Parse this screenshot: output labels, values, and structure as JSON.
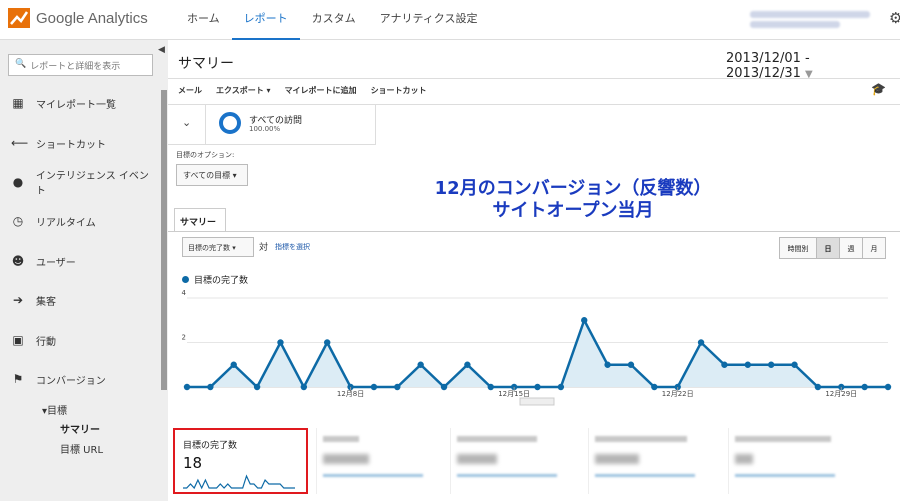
{
  "app": {
    "logo_text": "Google Analytics",
    "nav": [
      "ホーム",
      "レポート",
      "カスタム",
      "アナリティクス設定"
    ],
    "nav_active": 1
  },
  "sidebar": {
    "search_placeholder": "レポートと詳細を表示",
    "items": [
      {
        "icon": "grid-icon",
        "label": "マイレポート一覧"
      },
      {
        "icon": "shortcut-arrow-icon",
        "label": "ショートカット"
      },
      {
        "icon": "lightbulb-icon",
        "label": "インテリジェンス イベント"
      },
      {
        "icon": "clock-icon",
        "label": "リアルタイム"
      },
      {
        "icon": "users-icon",
        "label": "ユーザー"
      },
      {
        "icon": "acquisition-arrows-icon",
        "label": "集客"
      },
      {
        "icon": "behavior-box-icon",
        "label": "行動"
      },
      {
        "icon": "flag-icon",
        "label": "コンバージョン"
      }
    ],
    "sub_goal": "▾目標",
    "sub_summary": "サマリー",
    "sub_url": "目標 URL"
  },
  "main": {
    "title": "サマリー",
    "date_range": "2013/12/01 - 2013/12/31",
    "toolbar": [
      "メール",
      "エクスポート ▾",
      "マイレポートに追加",
      "ショートカット"
    ],
    "segment": {
      "name": "すべての訪問",
      "pct": "100.00%"
    },
    "goal_option_label": "目標のオプション:",
    "goal_option_value": "すべての目標",
    "overlay_line1": "12月のコンバージョン（反響数）",
    "overlay_line2": "サイトオープン当月",
    "tab": "サマリー",
    "metric_select": "目標の完了数",
    "vs": "対",
    "pick_metric": "指標を選択",
    "granularity": [
      "時間別",
      "日",
      "週",
      "月"
    ],
    "granularity_active": 1,
    "legend": "目標の完了数"
  },
  "chart_data": {
    "type": "area",
    "x": [
      "2013/12/01",
      "2013/12/02",
      "2013/12/03",
      "2013/12/04",
      "2013/12/05",
      "2013/12/06",
      "2013/12/07",
      "2013/12/08",
      "2013/12/09",
      "2013/12/10",
      "2013/12/11",
      "2013/12/12",
      "2013/12/13",
      "2013/12/14",
      "2013/12/15",
      "2013/12/16",
      "2013/12/17",
      "2013/12/18",
      "2013/12/19",
      "2013/12/20",
      "2013/12/21",
      "2013/12/22",
      "2013/12/23",
      "2013/12/24",
      "2013/12/25",
      "2013/12/26",
      "2013/12/27",
      "2013/12/28",
      "2013/12/29",
      "2013/12/30",
      "2013/12/31"
    ],
    "series": [
      {
        "name": "目標の完了数",
        "values": [
          0,
          0,
          1,
          0,
          2,
          0,
          2,
          0,
          0,
          0,
          1,
          0,
          1,
          0,
          0,
          0,
          0,
          3,
          1,
          1,
          0,
          0,
          2,
          1,
          1,
          1,
          1,
          0,
          0,
          0,
          0
        ]
      }
    ],
    "ylim": [
      0,
      4
    ],
    "yticks": [
      "4",
      "2"
    ],
    "xticks": [
      {
        "index": 7,
        "label": "12月8日"
      },
      {
        "index": 14,
        "label": "12月15日"
      },
      {
        "index": 21,
        "label": "12月22日"
      },
      {
        "index": 28,
        "label": "12月29日"
      }
    ],
    "line_color": "#0d6aa6",
    "fill_color": "#dcecf5"
  },
  "scorecard": {
    "label": "目標の完了数",
    "value": "18",
    "spark": [
      0,
      0,
      1,
      0,
      2,
      0,
      2,
      0,
      0,
      0,
      1,
      0,
      1,
      0,
      0,
      0,
      0,
      3,
      1,
      1,
      0,
      0,
      2,
      1,
      1,
      1,
      1,
      0,
      0,
      0,
      0
    ]
  }
}
